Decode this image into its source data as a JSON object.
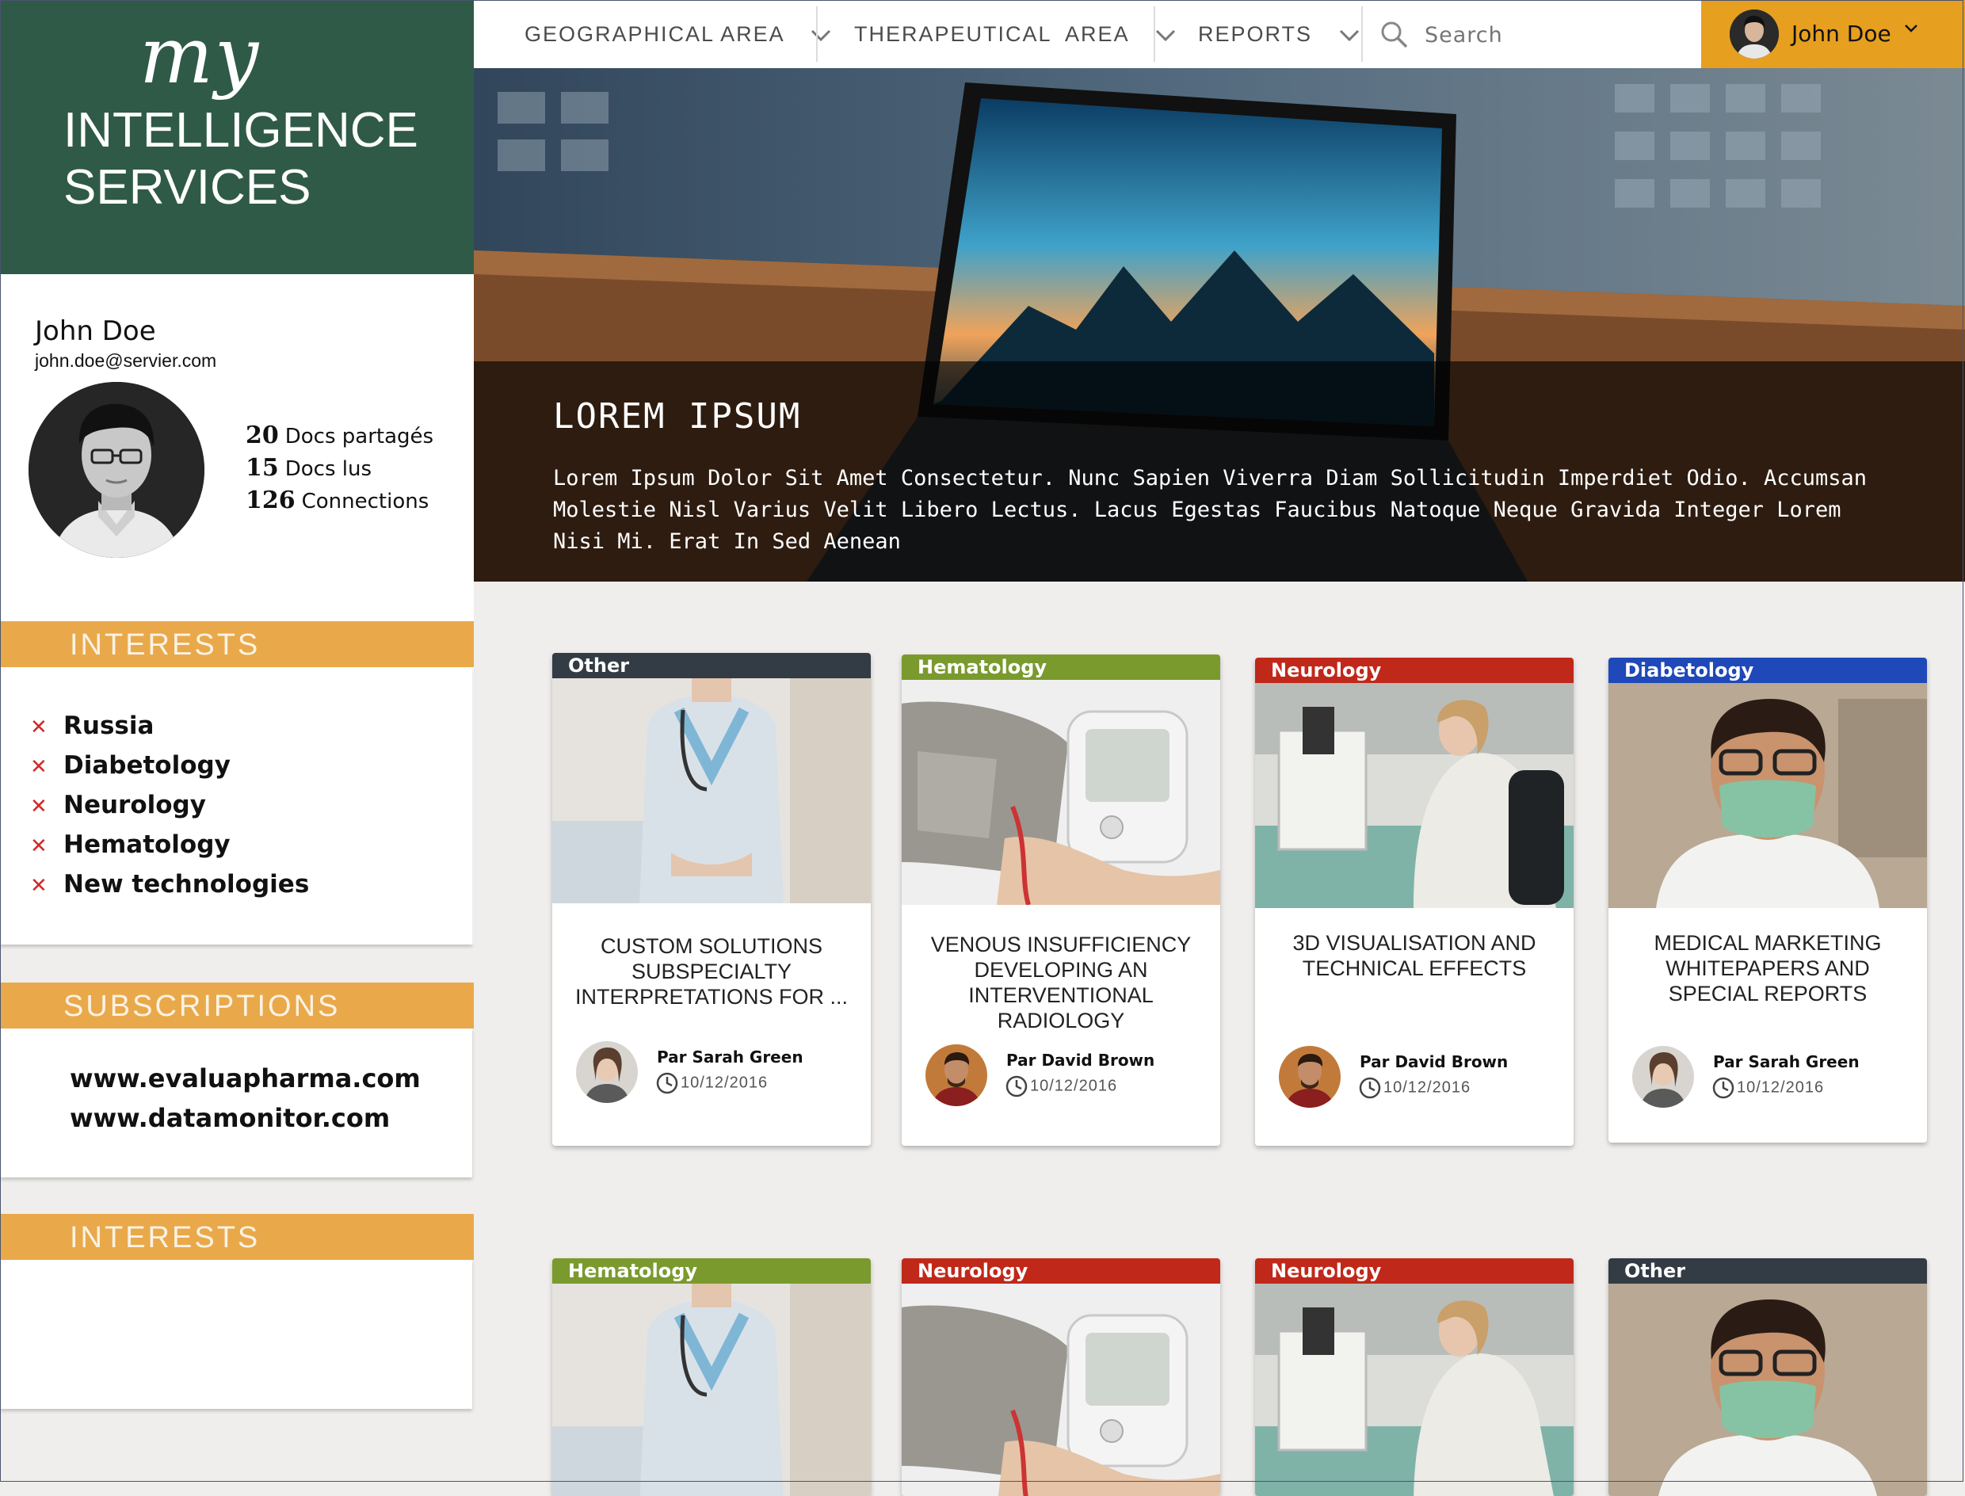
{
  "brand": {
    "my": "my",
    "line1": "INTELLIGENCE",
    "line2": "SERVICES"
  },
  "profile": {
    "name": "John Doe",
    "email": "john.doe@servier.com",
    "stats": [
      {
        "value": "20",
        "label": "Docs partagés"
      },
      {
        "value": "15",
        "label": "Docs lus"
      },
      {
        "value": "126",
        "label": "Connections"
      }
    ]
  },
  "interests": {
    "title": "INTERESTS",
    "items": [
      "Russia",
      "Diabetology",
      "Neurology",
      "Hematology",
      "New technologies"
    ]
  },
  "subscriptions": {
    "title": "SUBSCRIPTIONS",
    "items": [
      "www.evaluapharma.com",
      "www.datamonitor.com"
    ]
  },
  "interests2": {
    "title": "INTERESTS"
  },
  "nav": {
    "items": [
      "GEOGRAPHICAL AREA",
      "THERAPEUTICAL  AREA",
      "REPORTS"
    ],
    "search_placeholder": "Search",
    "user_name": "John Doe"
  },
  "hero": {
    "title": "LOREM IPSUM",
    "text": "Lorem Ipsum Dolor Sit Amet Consectetur. Nunc Sapien Viverra Diam Sollicitudin Imperdiet Odio. Accumsan Molestie Nisl Varius Velit Libero Lectus. Lacus Egestas Faucibus Natoque Neque Gravida Integer Lorem Nisi Mi. Erat In Sed Aenean"
  },
  "colors": {
    "Other": "#333b44",
    "Hematology": "#7a9a2e",
    "Neurology": "#c0281a",
    "Diabetology": "#1f48b8",
    "accent": "#e9a94a",
    "brand": "#2f5a47"
  },
  "cards": [
    {
      "tag": "Other",
      "image": "nurse",
      "title": "CUSTOM SOLUTIONS SUBSPECIALTY INTERPRETATIONS FOR ...",
      "author": "Par Sarah Green",
      "date": "10/12/2016"
    },
    {
      "tag": "Hematology",
      "image": "blood-pressure",
      "title": "VENOUS INSUFFICIENCY DEVELOPING AN INTERVENTIONAL RADIOLOGY",
      "author": "Par David Brown",
      "date": "10/12/2016"
    },
    {
      "tag": "Neurology",
      "image": "microscope",
      "title": "3D VISUALISATION AND TECHNICAL EFFECTS",
      "author": "Par David Brown",
      "date": "10/12/2016"
    },
    {
      "tag": "Diabetology",
      "image": "doctor-mask",
      "title": "MEDICAL MARKETING WHITEPAPERS AND SPECIAL REPORTS",
      "author": "Par Sarah Green",
      "date": "10/12/2016"
    },
    {
      "tag": "Hematology",
      "image": "nurse"
    },
    {
      "tag": "Neurology",
      "image": "blood-pressure"
    },
    {
      "tag": "Neurology",
      "image": "microscope"
    },
    {
      "tag": "Other",
      "image": "doctor-mask"
    }
  ]
}
